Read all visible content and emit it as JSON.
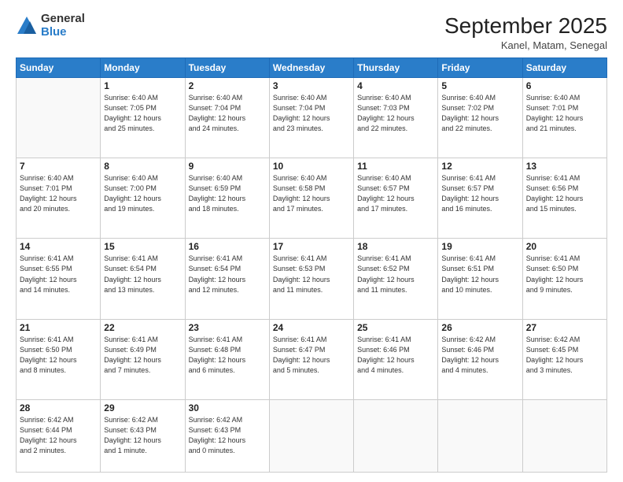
{
  "logo": {
    "general": "General",
    "blue": "Blue"
  },
  "header": {
    "month": "September 2025",
    "location": "Kanel, Matam, Senegal"
  },
  "weekdays": [
    "Sunday",
    "Monday",
    "Tuesday",
    "Wednesday",
    "Thursday",
    "Friday",
    "Saturday"
  ],
  "weeks": [
    [
      {
        "day": "",
        "info": ""
      },
      {
        "day": "1",
        "info": "Sunrise: 6:40 AM\nSunset: 7:05 PM\nDaylight: 12 hours\nand 25 minutes."
      },
      {
        "day": "2",
        "info": "Sunrise: 6:40 AM\nSunset: 7:04 PM\nDaylight: 12 hours\nand 24 minutes."
      },
      {
        "day": "3",
        "info": "Sunrise: 6:40 AM\nSunset: 7:04 PM\nDaylight: 12 hours\nand 23 minutes."
      },
      {
        "day": "4",
        "info": "Sunrise: 6:40 AM\nSunset: 7:03 PM\nDaylight: 12 hours\nand 22 minutes."
      },
      {
        "day": "5",
        "info": "Sunrise: 6:40 AM\nSunset: 7:02 PM\nDaylight: 12 hours\nand 22 minutes."
      },
      {
        "day": "6",
        "info": "Sunrise: 6:40 AM\nSunset: 7:01 PM\nDaylight: 12 hours\nand 21 minutes."
      }
    ],
    [
      {
        "day": "7",
        "info": "Sunrise: 6:40 AM\nSunset: 7:01 PM\nDaylight: 12 hours\nand 20 minutes."
      },
      {
        "day": "8",
        "info": "Sunrise: 6:40 AM\nSunset: 7:00 PM\nDaylight: 12 hours\nand 19 minutes."
      },
      {
        "day": "9",
        "info": "Sunrise: 6:40 AM\nSunset: 6:59 PM\nDaylight: 12 hours\nand 18 minutes."
      },
      {
        "day": "10",
        "info": "Sunrise: 6:40 AM\nSunset: 6:58 PM\nDaylight: 12 hours\nand 17 minutes."
      },
      {
        "day": "11",
        "info": "Sunrise: 6:40 AM\nSunset: 6:57 PM\nDaylight: 12 hours\nand 17 minutes."
      },
      {
        "day": "12",
        "info": "Sunrise: 6:41 AM\nSunset: 6:57 PM\nDaylight: 12 hours\nand 16 minutes."
      },
      {
        "day": "13",
        "info": "Sunrise: 6:41 AM\nSunset: 6:56 PM\nDaylight: 12 hours\nand 15 minutes."
      }
    ],
    [
      {
        "day": "14",
        "info": "Sunrise: 6:41 AM\nSunset: 6:55 PM\nDaylight: 12 hours\nand 14 minutes."
      },
      {
        "day": "15",
        "info": "Sunrise: 6:41 AM\nSunset: 6:54 PM\nDaylight: 12 hours\nand 13 minutes."
      },
      {
        "day": "16",
        "info": "Sunrise: 6:41 AM\nSunset: 6:54 PM\nDaylight: 12 hours\nand 12 minutes."
      },
      {
        "day": "17",
        "info": "Sunrise: 6:41 AM\nSunset: 6:53 PM\nDaylight: 12 hours\nand 11 minutes."
      },
      {
        "day": "18",
        "info": "Sunrise: 6:41 AM\nSunset: 6:52 PM\nDaylight: 12 hours\nand 11 minutes."
      },
      {
        "day": "19",
        "info": "Sunrise: 6:41 AM\nSunset: 6:51 PM\nDaylight: 12 hours\nand 10 minutes."
      },
      {
        "day": "20",
        "info": "Sunrise: 6:41 AM\nSunset: 6:50 PM\nDaylight: 12 hours\nand 9 minutes."
      }
    ],
    [
      {
        "day": "21",
        "info": "Sunrise: 6:41 AM\nSunset: 6:50 PM\nDaylight: 12 hours\nand 8 minutes."
      },
      {
        "day": "22",
        "info": "Sunrise: 6:41 AM\nSunset: 6:49 PM\nDaylight: 12 hours\nand 7 minutes."
      },
      {
        "day": "23",
        "info": "Sunrise: 6:41 AM\nSunset: 6:48 PM\nDaylight: 12 hours\nand 6 minutes."
      },
      {
        "day": "24",
        "info": "Sunrise: 6:41 AM\nSunset: 6:47 PM\nDaylight: 12 hours\nand 5 minutes."
      },
      {
        "day": "25",
        "info": "Sunrise: 6:41 AM\nSunset: 6:46 PM\nDaylight: 12 hours\nand 4 minutes."
      },
      {
        "day": "26",
        "info": "Sunrise: 6:42 AM\nSunset: 6:46 PM\nDaylight: 12 hours\nand 4 minutes."
      },
      {
        "day": "27",
        "info": "Sunrise: 6:42 AM\nSunset: 6:45 PM\nDaylight: 12 hours\nand 3 minutes."
      }
    ],
    [
      {
        "day": "28",
        "info": "Sunrise: 6:42 AM\nSunset: 6:44 PM\nDaylight: 12 hours\nand 2 minutes."
      },
      {
        "day": "29",
        "info": "Sunrise: 6:42 AM\nSunset: 6:43 PM\nDaylight: 12 hours\nand 1 minute."
      },
      {
        "day": "30",
        "info": "Sunrise: 6:42 AM\nSunset: 6:43 PM\nDaylight: 12 hours\nand 0 minutes."
      },
      {
        "day": "",
        "info": ""
      },
      {
        "day": "",
        "info": ""
      },
      {
        "day": "",
        "info": ""
      },
      {
        "day": "",
        "info": ""
      }
    ]
  ]
}
